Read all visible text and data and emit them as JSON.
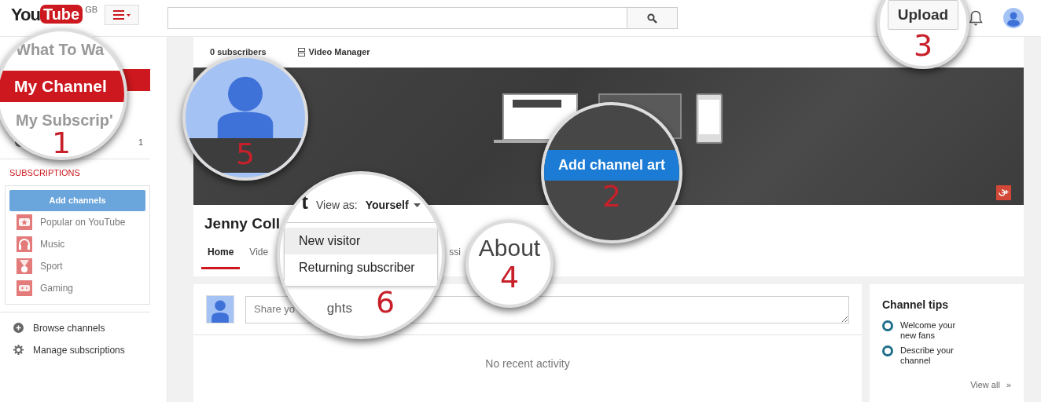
{
  "header": {
    "logo_left": "You",
    "logo_right": "Tube",
    "region": "GB"
  },
  "sidebar": {
    "watch_later_count": "1",
    "subscriptions_heading": "SUBSCRIPTIONS",
    "add_button": "Add channels",
    "channels": [
      {
        "label": "Popular on YouTube",
        "kind": "star"
      },
      {
        "label": "Music",
        "kind": "headphones"
      },
      {
        "label": "Sport",
        "kind": "medal"
      },
      {
        "label": "Gaming",
        "kind": "gamepad"
      }
    ],
    "links": [
      {
        "label": "Browse channels",
        "kind": "plus"
      },
      {
        "label": "Manage subscriptions",
        "kind": "gear"
      }
    ]
  },
  "channel": {
    "subscribers": "0 subscribers",
    "video_manager": "Video Manager",
    "name": "Jenny Coll",
    "tabs": [
      {
        "label": "Home",
        "selected": true
      },
      {
        "label": "Vide",
        "selected": false
      },
      {
        "label": "ssi",
        "selected": false
      }
    ],
    "share": {
      "placeholder": "Share yo"
    },
    "activity": "No recent activity"
  },
  "tips": {
    "title": "Channel tips",
    "items": [
      "Welcome your new fans",
      "Describe your channel"
    ],
    "view_all": "View all",
    "more": "»"
  },
  "callouts": [
    {
      "kind": "guide",
      "number": "1",
      "items": [
        {
          "label": "What To Wa",
          "selected": false
        },
        {
          "label": "My Channel",
          "selected": true
        },
        {
          "label": "My Subscrip'",
          "selected": false
        }
      ]
    },
    {
      "kind": "button",
      "number": "2",
      "label": "Add channel art"
    },
    {
      "kind": "upload",
      "number": "3",
      "label": "Upload"
    },
    {
      "kind": "text",
      "number": "4",
      "label": "About"
    },
    {
      "kind": "avatar",
      "number": "5"
    },
    {
      "kind": "menu",
      "number": "6",
      "fragment": "t",
      "view_as_label": "View as:",
      "view_as_value": "Yourself",
      "options": [
        {
          "label": "New visitor",
          "selected": true
        },
        {
          "label": "Returning subscriber",
          "selected": false
        }
      ],
      "below_fragment": "ghts"
    }
  ]
}
